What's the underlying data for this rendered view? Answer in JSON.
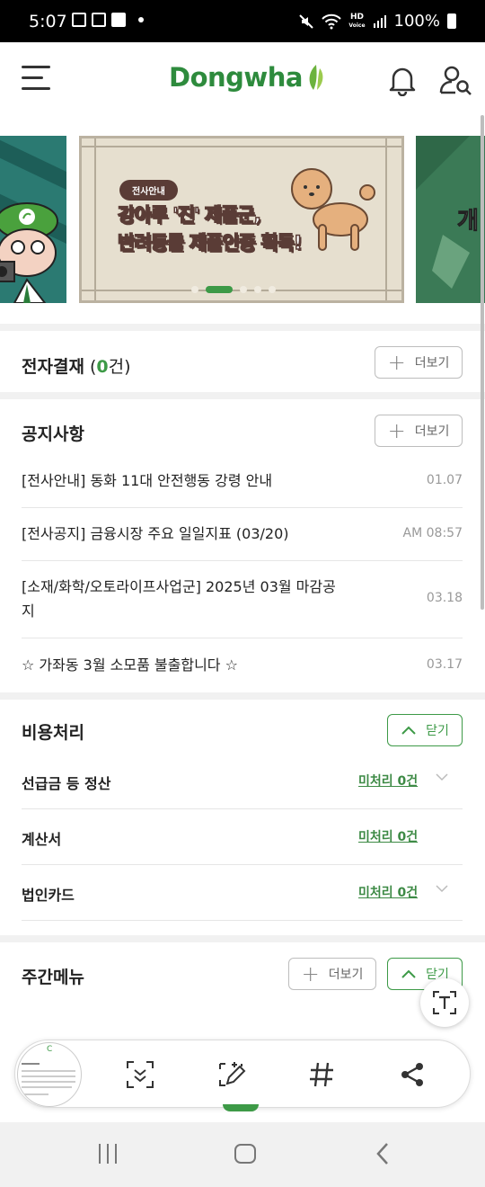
{
  "status_bar": {
    "time": "5:07",
    "hd_label": "HD",
    "volte_label": "Voice",
    "battery": "100%"
  },
  "header": {
    "logo_text": "Dongwha"
  },
  "banner": {
    "tag": "전사안내",
    "headline_line1_a": "강아루 '",
    "headline_line1_hl": "진",
    "headline_line1_b": "' 제품군,",
    "headline_line2": "반려동물 제품인증 획득!",
    "right_slide_text": "개"
  },
  "approval": {
    "title": "전자결재",
    "paren_open": " (",
    "count": "0",
    "unit": "건)",
    "more_label": "더보기"
  },
  "notice": {
    "title": "공지사항",
    "more_label": "더보기",
    "items": [
      {
        "title": "[전사안내] 동화 11대 안전행동 강령 안내",
        "date": "01.07"
      },
      {
        "title": "[전사공지] 금융시장 주요 일일지표 (03/20)",
        "date": "AM 08:57"
      },
      {
        "title_line1": "[소재/화학/오토라이프사업군] 2025년 03월 마감공",
        "title_line2": "지",
        "date": "03.18"
      },
      {
        "title": "☆ 가좌동 3월 소모품 불출합니다 ☆",
        "date": "03.17"
      }
    ]
  },
  "expense": {
    "title": "비용처리",
    "close_label": "닫기",
    "rows": [
      {
        "label": "선급금 등 정산",
        "count": "미처리 0건"
      },
      {
        "label": "계산서",
        "count": "미처리 0건"
      },
      {
        "label": "법인카드",
        "count": "미처리 0건"
      }
    ]
  },
  "weekly_menu": {
    "title": "주간메뉴",
    "more_label": "더보기",
    "close_label": "닫기"
  },
  "thumbnail": {
    "letter": "C"
  }
}
